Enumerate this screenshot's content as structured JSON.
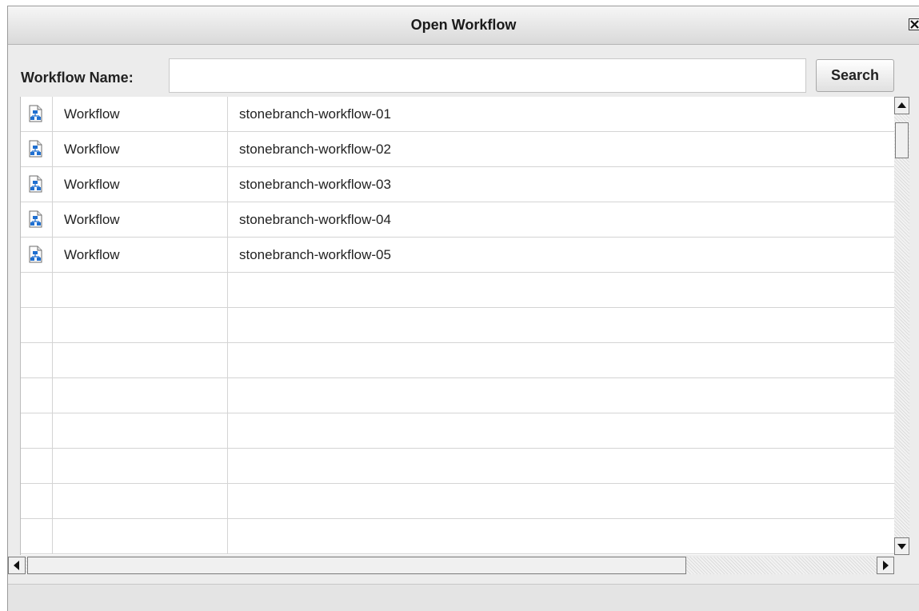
{
  "dialog": {
    "title": "Open Workflow",
    "close_icon": "close-x-icon"
  },
  "search": {
    "label": "Workflow Name:",
    "value": "",
    "placeholder": "",
    "button_label": "Search"
  },
  "results": {
    "row_icon": "workflow-document-icon",
    "rows": [
      {
        "type": "Workflow",
        "name": "stonebranch-workflow-01"
      },
      {
        "type": "Workflow",
        "name": "stonebranch-workflow-02"
      },
      {
        "type": "Workflow",
        "name": "stonebranch-workflow-03"
      },
      {
        "type": "Workflow",
        "name": "stonebranch-workflow-04"
      },
      {
        "type": "Workflow",
        "name": "stonebranch-workflow-05"
      }
    ],
    "empty_row_count": 8
  },
  "scrollbars": {
    "vertical_up_icon": "arrow-up-icon",
    "vertical_down_icon": "arrow-down-icon",
    "horizontal_left_icon": "arrow-left-icon",
    "horizontal_right_icon": "arrow-right-icon"
  },
  "colors": {
    "titlebar_top": "#f6f6f6",
    "titlebar_bottom": "#d9d9d9",
    "dialog_bg": "#ececec",
    "grid_line": "#d4d4d4",
    "icon_blue": "#1f6fd0"
  }
}
